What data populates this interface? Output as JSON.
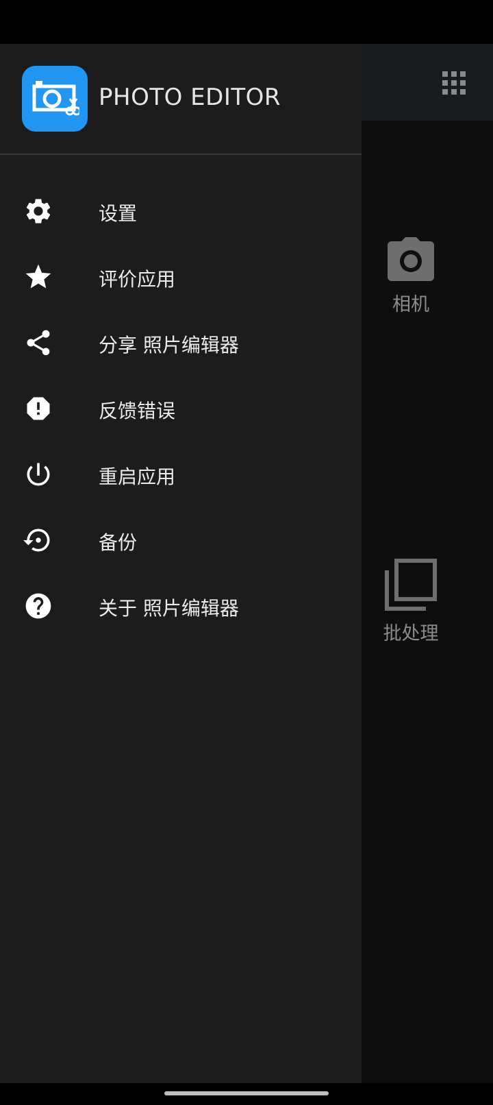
{
  "drawer": {
    "app_name": "PHOTO EDITOR",
    "menu": [
      {
        "label": "设置",
        "icon": "gear-icon"
      },
      {
        "label": "评价应用",
        "icon": "star-icon"
      },
      {
        "label": "分享 照片编辑器",
        "icon": "share-icon"
      },
      {
        "label": "反馈错误",
        "icon": "alert-icon"
      },
      {
        "label": "重启应用",
        "icon": "power-icon"
      },
      {
        "label": "备份",
        "icon": "backup-restore-icon"
      },
      {
        "label": "关于 照片编辑器",
        "icon": "help-icon"
      }
    ]
  },
  "background": {
    "tiles": [
      {
        "label": "相机",
        "icon": "camera-icon"
      },
      {
        "label": "批处理",
        "icon": "batch-icon"
      }
    ],
    "toolbar_icon": "grid-icon"
  },
  "colors": {
    "accent": "#2196f3",
    "drawer_bg": "#1c1c1c",
    "toolbar_bg": "#181c20",
    "content_bg": "#0e0e0e"
  }
}
